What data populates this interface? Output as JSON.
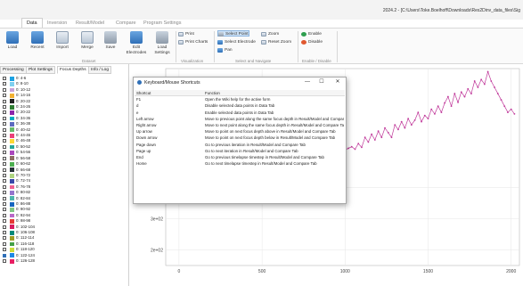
{
  "window": {
    "title": "2024.2 - [C:\\Users\\Toke.Boelhoff\\Downloads\\Res2Dinv_data_files\\Sig"
  },
  "menu_tabs": [
    {
      "label": "Data",
      "active": true
    },
    {
      "label": "Inversion",
      "active": false
    },
    {
      "label": "Result/Model",
      "active": false
    },
    {
      "label": "Compare",
      "active": false
    },
    {
      "label": "Program Settings",
      "active": false
    }
  ],
  "ribbon": {
    "load": "Load",
    "recent": "Recent",
    "import": "Import",
    "merge": "Merge",
    "save": "Save",
    "edit_electrodes": "Edit Electrodes",
    "load_settings": "Load Settings",
    "dataset_group": "Dataset",
    "print": "Print",
    "print_charts": "Print Charts",
    "visualization_group": "Visualization",
    "select_point": "Select Point",
    "select_electrode": "Select Electrode",
    "pan": "Pan",
    "zoom": "Zoom",
    "reset_zoom": "Reset Zoom",
    "select_navigate_group": "Select and Navigate",
    "enable": "Enable",
    "disable": "Disable",
    "enable_disable_group": "Enable / Disable"
  },
  "panel_tabs": [
    "Processing",
    "Plot Settings",
    "Focus Depths",
    "Info / Log"
  ],
  "depths": [
    {
      "label": "0: 4-6",
      "color": "#1ba1e2",
      "checked": false
    },
    {
      "label": "0: 8-10",
      "color": "#7fd0f0",
      "checked": false
    },
    {
      "label": "0: 10-12",
      "color": "#c7a1d9",
      "checked": false
    },
    {
      "label": "0: 14-16",
      "color": "#f2b134",
      "checked": false
    },
    {
      "label": "0: 20-22",
      "color": "#222222",
      "checked": false
    },
    {
      "label": "0: 24-26",
      "color": "#2e7d32",
      "checked": false
    },
    {
      "label": "0: 20-22",
      "color": "#8e24aa",
      "checked": false
    },
    {
      "label": "0: 34-36",
      "color": "#00acc1",
      "checked": false
    },
    {
      "label": "0: 36-38",
      "color": "#5c6bc0",
      "checked": false
    },
    {
      "label": "0: 40-42",
      "color": "#66bb6a",
      "checked": false
    },
    {
      "label": "0: 44-46",
      "color": "#ec407a",
      "checked": false
    },
    {
      "label": "0: 46-48",
      "color": "#fdd835",
      "checked": false
    },
    {
      "label": "0: 50-52",
      "color": "#26a69a",
      "checked": false
    },
    {
      "label": "0: 54-56",
      "color": "#ab47bc",
      "checked": false
    },
    {
      "label": "0: 56-58",
      "color": "#8d6e63",
      "checked": false
    },
    {
      "label": "0: 60-62",
      "color": "#4caf50",
      "checked": false
    },
    {
      "label": "0: 66-68",
      "color": "#263238",
      "checked": false
    },
    {
      "label": "0: 70-72",
      "color": "#aed581",
      "checked": false
    },
    {
      "label": "0: 72-74",
      "color": "#3949ab",
      "checked": false
    },
    {
      "label": "0: 76-78",
      "color": "#f06292",
      "checked": false
    },
    {
      "label": "0: 80-82",
      "color": "#9575cd",
      "checked": false
    },
    {
      "label": "0: 82-84",
      "color": "#4db6ac",
      "checked": false
    },
    {
      "label": "0: 86-88",
      "color": "#1565c0",
      "checked": false
    },
    {
      "label": "0: 90-92",
      "color": "#81c784",
      "checked": false
    },
    {
      "label": "0: 92-94",
      "color": "#ba68c8",
      "checked": false
    },
    {
      "label": "0: 98-98",
      "color": "#e53935",
      "checked": false
    },
    {
      "label": "0: 102-104",
      "color": "#d81b60",
      "checked": false
    },
    {
      "label": "0: 106-108",
      "color": "#00897b",
      "checked": false
    },
    {
      "label": "0: 112-114",
      "color": "#9e9d24",
      "checked": false
    },
    {
      "label": "0: 116-118",
      "color": "#43a047",
      "checked": false
    },
    {
      "label": "0: 118-120",
      "color": "#cddc39",
      "checked": false
    },
    {
      "label": "0: 122-124",
      "color": "#1e88e5",
      "checked": true
    },
    {
      "label": "0: 126-128",
      "color": "#e91e63",
      "checked": false
    }
  ],
  "dialog": {
    "title": "Keyboard/Mouse Shortcuts",
    "headers": [
      "Shortcut",
      "Function"
    ],
    "rows": [
      [
        "F1",
        "Open the Wiki help for the active form"
      ],
      [
        "d",
        "Disable selected data points in Data Tab"
      ],
      [
        "e",
        "Enable selected data points in Data Tab"
      ],
      [
        "Left arrow",
        "Move to previous point along the same focus depth in Result/Model and Compare Tab"
      ],
      [
        "Right arrow",
        "Move to next point along the same focus depth in Result/Model and Compare Tab"
      ],
      [
        "Up arrow",
        "Move to point on next focus depth above in Result/Model and Compare Tab"
      ],
      [
        "Down arrow",
        "Move to point on next focus depth below in Result/Model and Compare Tab"
      ],
      [
        "Page down",
        "Go to previous iteration in Result/Model and Compare Tab"
      ],
      [
        "Page up",
        "Go to next iteration in Result/Model and Compare Tab"
      ],
      [
        "End",
        "Go to previous timelapse timestep in Result/Model and Compare Tab"
      ],
      [
        "Home",
        "Go to next timelapse timestep in Result/Model and Compare Tab"
      ]
    ]
  },
  "chart_data": {
    "type": "line",
    "y_tick_labels": [
      "4e+02",
      "3e+02",
      "2e+02"
    ],
    "y_ticks": [
      400,
      300,
      200
    ],
    "x_tick_labels": [
      "0",
      "500",
      "1000",
      "1500",
      "2000"
    ],
    "x_ticks": [
      0,
      500,
      1000,
      1500,
      2000
    ],
    "xlim": [
      -80,
      2050
    ],
    "ylim": [
      150,
      780
    ],
    "series": [
      {
        "color": "#c0399a",
        "x": [
          1000,
          1020,
          1040,
          1060,
          1080,
          1100,
          1120,
          1140,
          1160,
          1180,
          1200,
          1220,
          1240,
          1260,
          1280,
          1300,
          1320,
          1340,
          1360,
          1380,
          1400,
          1420,
          1440,
          1460,
          1480,
          1500,
          1520,
          1540,
          1560,
          1580,
          1600,
          1620,
          1640,
          1660,
          1680,
          1700,
          1720,
          1740,
          1760,
          1780,
          1800,
          1820,
          1840,
          1860,
          1880,
          1900,
          1920,
          1940,
          1960,
          1980,
          2000,
          2020
        ],
        "y": [
          520,
          525,
          530,
          522,
          540,
          528,
          560,
          545,
          570,
          552,
          580,
          560,
          590,
          575,
          560,
          600,
          585,
          610,
          590,
          620,
          600,
          615,
          640,
          610,
          630,
          620,
          650,
          635,
          660,
          640,
          670,
          690,
          660,
          700,
          672,
          705,
          690,
          715,
          700,
          740,
          720,
          745,
          730,
          770,
          740,
          720,
          700,
          680,
          660,
          640,
          650,
          635
        ]
      }
    ]
  }
}
